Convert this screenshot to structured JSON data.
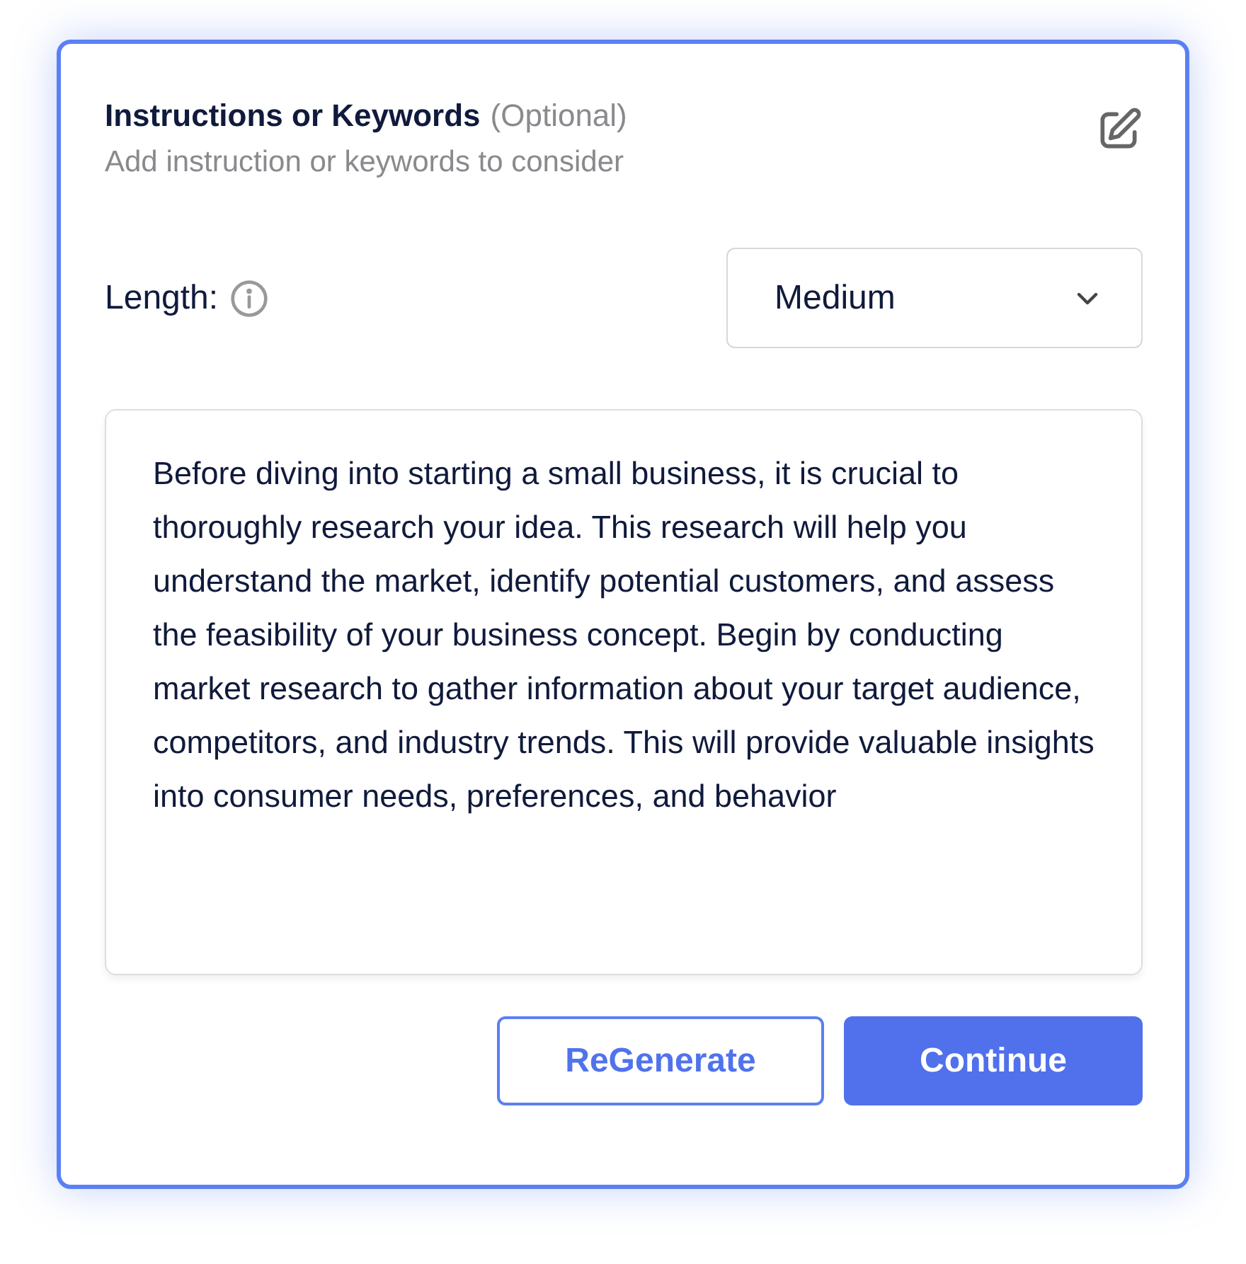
{
  "header": {
    "title": "Instructions or Keywords",
    "optional": "(Optional)",
    "subtitle": "Add instruction or keywords to consider"
  },
  "length": {
    "label": "Length:",
    "value": "Medium"
  },
  "output": {
    "text": "Before diving into starting a small business, it is crucial to thoroughly research your idea. This research will help you understand the market, identify potential customers, and assess the feasibility of your business concept. Begin by conducting market research to gather information about your target audience, competitors, and industry trends. This will provide valuable insights into consumer needs, preferences, and behavior"
  },
  "buttons": [
    {
      "label": "ReGenerate",
      "kind": "secondary"
    },
    {
      "label": "Continue",
      "kind": "primary"
    }
  ]
}
